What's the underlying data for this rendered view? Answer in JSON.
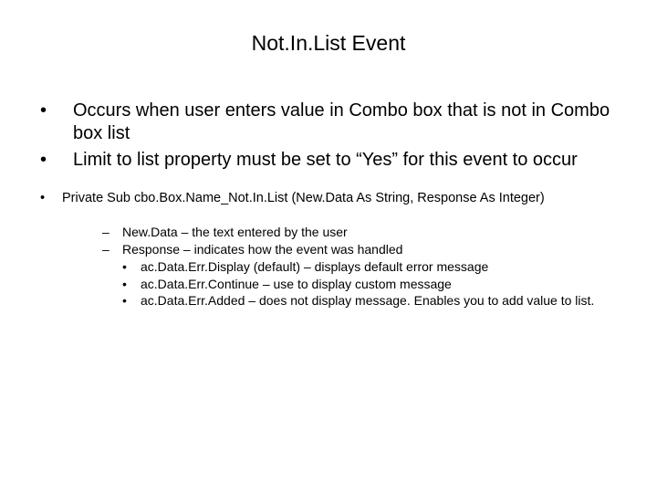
{
  "title": "Not.In.List Event",
  "bullets_l1": [
    "Occurs when user enters value in Combo box that is not in Combo box list",
    "Limit to list property must be set to “Yes” for this event to occur"
  ],
  "bullet_l2": "Private Sub cbo.Box.Name_Not.In.List (New.Data As String, Response As Integer)",
  "bullets_l3": [
    "New.Data – the text entered by the user",
    "Response – indicates how the event was handled"
  ],
  "bullets_l4": [
    "ac.Data.Err.Display (default) – displays default error message",
    "ac.Data.Err.Continue – use to display custom message",
    "ac.Data.Err.Added – does not display message. Enables you to add value to list."
  ],
  "markers": {
    "bullet": "•",
    "dash": "–"
  }
}
